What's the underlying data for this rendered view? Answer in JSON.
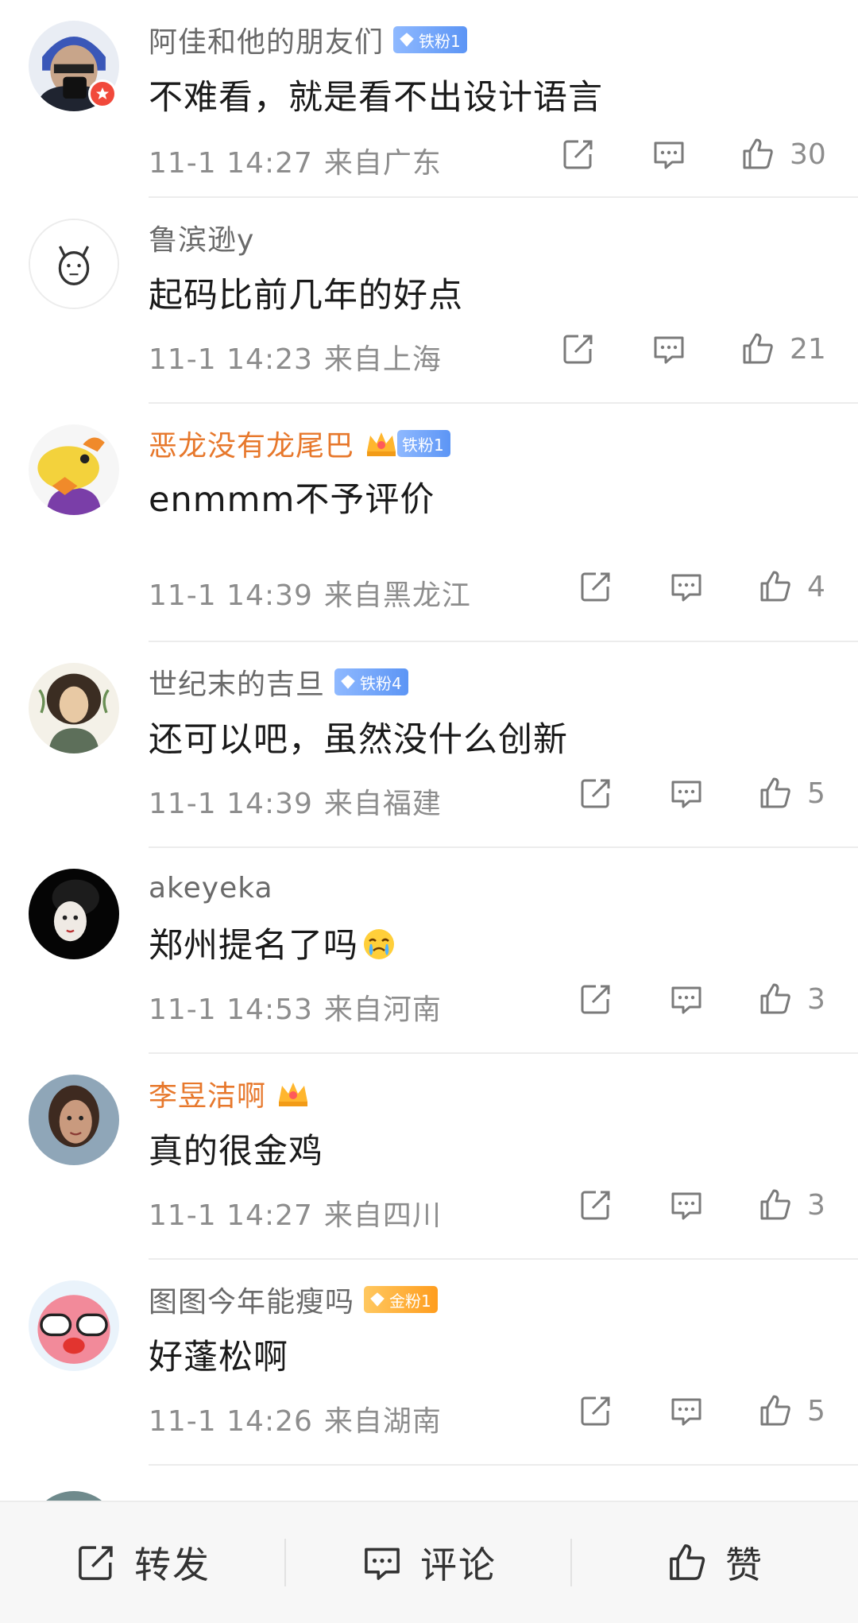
{
  "comments": [
    {
      "username": "阿佳和他的朋友们",
      "badge": "铁粉1",
      "text": "不难看，就是看不出设计语言",
      "date": "11-1 14:27",
      "location": "来自广东",
      "likes": "30"
    },
    {
      "username": "鲁滨逊y",
      "badge": "",
      "text": "起码比前几年的好点",
      "date": "11-1 14:23",
      "location": "来自上海",
      "likes": "21"
    },
    {
      "username": "恶龙没有龙尾巴",
      "badge": "铁粉1",
      "text": "enmmm不予评价",
      "date": "11-1 14:39",
      "location": "来自黑龙江",
      "likes": "4"
    },
    {
      "username": "世纪末的吉旦",
      "badge": "铁粉4",
      "text": "还可以吧，虽然没什么创新",
      "date": "11-1 14:39",
      "location": "来自福建",
      "likes": "5"
    },
    {
      "username": "akeyeka",
      "badge": "",
      "text": "郑州提名了吗",
      "date": "11-1 14:53",
      "location": "来自河南",
      "likes": "3"
    },
    {
      "username": "李昱洁啊",
      "badge": "",
      "text": "真的很金鸡",
      "date": "11-1 14:27",
      "location": "来自四川",
      "likes": "3"
    },
    {
      "username": "图图今年能瘦吗",
      "badge": "金粉1",
      "text": "好蓬松啊",
      "date": "11-1 14:26",
      "location": "来自湖南",
      "likes": "5"
    }
  ],
  "bottom_bar": {
    "repost": "转发",
    "comment": "评论",
    "like": "赞"
  },
  "colors": {
    "orange_name": "#e7782c",
    "blue_badge": "#6a9ef7",
    "gold_badge": "#ffa92c",
    "vip_red": "#f1493b"
  }
}
